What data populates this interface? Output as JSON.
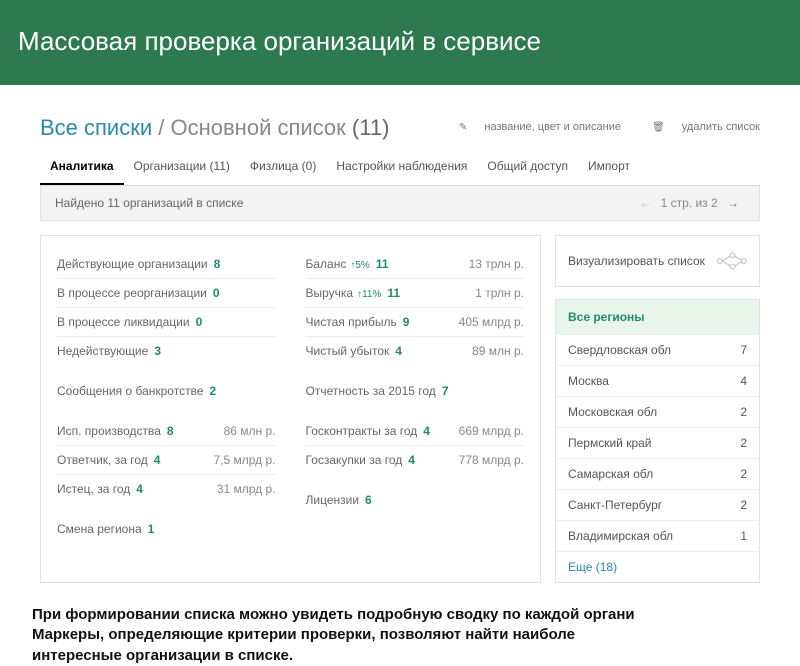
{
  "banner": {
    "title": "Массовая проверка организаций в сервисе"
  },
  "breadcrumb": {
    "root": "Все списки",
    "current": "Основной список",
    "count": "(11)"
  },
  "title_actions": {
    "edit": "название, цвет и описание",
    "delete": "удалить список"
  },
  "tabs": [
    {
      "label": "Аналитика",
      "active": true
    },
    {
      "label": "Организации (11)"
    },
    {
      "label": "Физлица (0)"
    },
    {
      "label": "Настройки наблюдения"
    },
    {
      "label": "Общий доступ"
    },
    {
      "label": "Импорт"
    }
  ],
  "summary": {
    "found": "Найдено 11 организаций в списке",
    "pager": "1 стр. из 2"
  },
  "left_col": {
    "block1": [
      {
        "label": "Действующие организации",
        "num": "8"
      },
      {
        "label": "В процессе реорганизации",
        "num": "0"
      },
      {
        "label": "В процессе ликвидации",
        "num": "0"
      },
      {
        "label": "Недействующие",
        "num": "3"
      }
    ],
    "block2": [
      {
        "label": "Сообщения о банкротстве",
        "num": "2"
      }
    ],
    "block3": [
      {
        "label": "Исп. производства",
        "num": "8",
        "right": "86 млн р."
      },
      {
        "label": "Ответчик, за год",
        "num": "4",
        "right": "7,5 млрд р."
      },
      {
        "label": "Истец, за год",
        "num": "4",
        "right": "31 млрд р."
      }
    ],
    "block4": [
      {
        "label": "Смена региона",
        "num": "1"
      }
    ]
  },
  "right_col": {
    "block1": [
      {
        "label": "Баланс",
        "up": "↑5%",
        "num": "11",
        "right": "13 трлн р."
      },
      {
        "label": "Выручка",
        "up": "↑11%",
        "num": "11",
        "right": "1 трлн р."
      },
      {
        "label": "Чистая прибыль",
        "num": "9",
        "right": "405 млрд р."
      },
      {
        "label": "Чистый убыток",
        "num": "4",
        "right": "89 млн р."
      }
    ],
    "block2": [
      {
        "label": "Отчетность за 2015 год",
        "num": "7"
      }
    ],
    "block3": [
      {
        "label": "Госконтракты за год",
        "num": "4",
        "right": "669 млрд р."
      },
      {
        "label": "Госзакупки за год",
        "num": "4",
        "right": "778 млрд р."
      }
    ],
    "block4": [
      {
        "label": "Лицензии",
        "num": "6"
      }
    ]
  },
  "visualize": "Визуализировать список",
  "regions": {
    "head": "Все регионы",
    "items": [
      {
        "name": "Свердловская обл",
        "n": "7"
      },
      {
        "name": "Москва",
        "n": "4"
      },
      {
        "name": "Московская обл",
        "n": "2"
      },
      {
        "name": "Пермский край",
        "n": "2"
      },
      {
        "name": "Самарская обл",
        "n": "2"
      },
      {
        "name": "Санкт-Петербург",
        "n": "2"
      },
      {
        "name": "Владимирская обл",
        "n": "1"
      }
    ],
    "more": "Еще (18)"
  },
  "footer": {
    "l1": "При формировании списка можно увидеть подробную сводку по каждой органи",
    "l2": "Маркеры, определяющие критерии проверки, позволяют найти наиболе",
    "l3": "интересные организации в списке."
  }
}
